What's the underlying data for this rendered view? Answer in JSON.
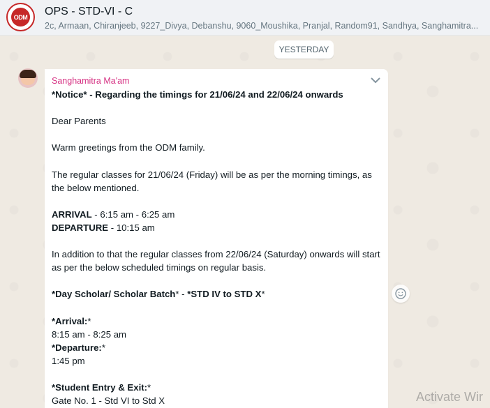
{
  "header": {
    "title": "OPS - STD-VI - C",
    "members": "2c, Armaan, Chiranjeeb, 9227_Divya, Debanshu, 9060_Moushika, Pranjal, Random91, Sandhya, Sanghamitra...",
    "avatar_text": "ODM"
  },
  "chat": {
    "date_chip": "YESTERDAY"
  },
  "message": {
    "sender": "Sanghamitra Ma'am",
    "sender_color": "#d63384",
    "lines": {
      "l1_pre": "*Notice*",
      "l1_bold": " - Regarding the timings for 21/06/24 and 22/06/24 onwards",
      "l3": "Dear Parents",
      "l5": "Warm greetings from the ODM family.",
      "l7": "The regular classes for 21/06/24 (Friday) will be as per the morning timings, as the below mentioned.",
      "l9_bold": "ARRIVAL",
      "l9_rest": " - 6:15 am - 6:25 am",
      "l10_bold": "DEPARTURE",
      "l10_rest": " - 10:15 am",
      "l12": "In addition to that the regular classes from 22/06/24 (Saturday) onwards will start as per the below scheduled timings on regular basis.",
      "l14_bold1": "*Day Scholar/ Scholar Batch",
      "l14_mid": "*  - ",
      "l14_bold2": "*STD IV to STD X",
      "l14_end": "*",
      "l16_bold": "*Arrival:",
      "l16_end": "*",
      "l17": "8:15 am - 8:25 am",
      "l18_bold": "*Departure:",
      "l18_end": "*",
      "l19": "1:45 pm",
      "l21_bold": "*Student Entry & Exit:",
      "l21_end": "*",
      "l22": "Gate No. 1 - Std VI to Std X"
    }
  },
  "watermark": "Activate Wir",
  "icons": {
    "chevron": "chevron-down-icon",
    "emoji": "emoji-icon"
  }
}
